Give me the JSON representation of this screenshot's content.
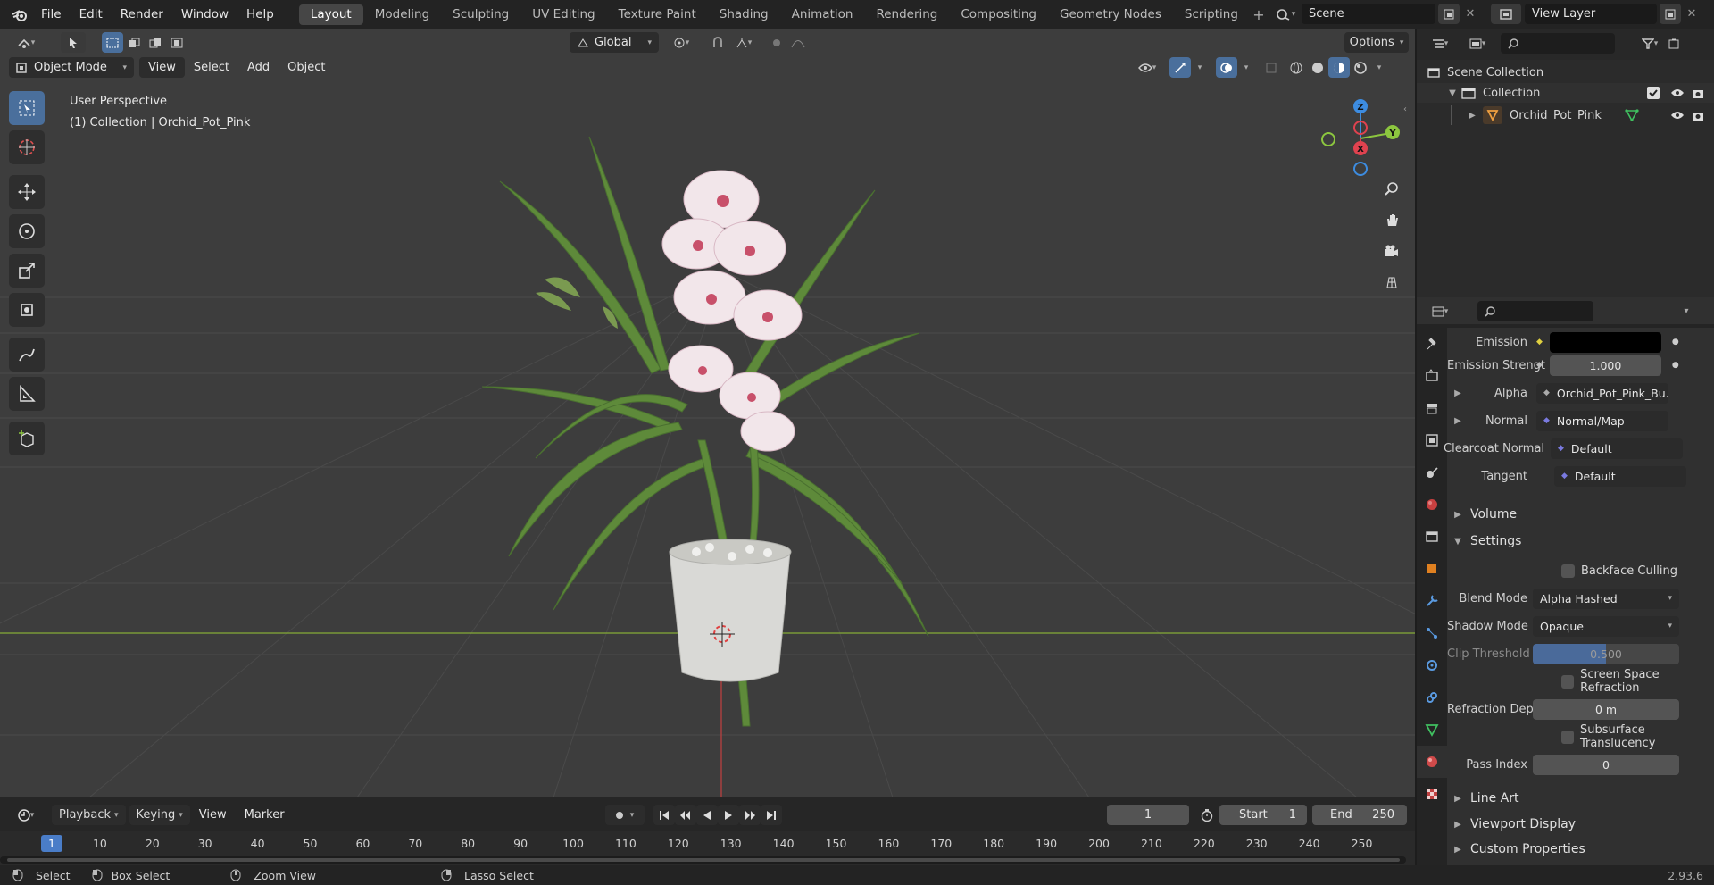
{
  "topbar": {
    "menus": [
      "File",
      "Edit",
      "Render",
      "Window",
      "Help"
    ],
    "workspaces": [
      "Layout",
      "Modeling",
      "Sculpting",
      "UV Editing",
      "Texture Paint",
      "Shading",
      "Animation",
      "Rendering",
      "Compositing",
      "Geometry Nodes",
      "Scripting"
    ],
    "active_workspace": "Layout",
    "scene": "Scene",
    "view_layer": "View Layer"
  },
  "viewport": {
    "mode": "Object Mode",
    "menus": [
      "View",
      "Select",
      "Add",
      "Object"
    ],
    "transform_orientation": "Global",
    "options_label": "Options",
    "overlay_line1": "User Perspective",
    "overlay_line2": "(1) Collection | Orchid_Pot_Pink",
    "gizmo_axes": {
      "x": "X",
      "y": "Y",
      "z": "Z"
    }
  },
  "outliner": {
    "root": "Scene Collection",
    "collection": "Collection",
    "object": "Orchid_Pot_Pink"
  },
  "properties": {
    "emission_label": "Emission",
    "emission_strength_label": "Emission Strengt",
    "emission_strength_value": "1.000",
    "alpha_label": "Alpha",
    "alpha_value": "Orchid_Pot_Pink_Bu...",
    "normal_label": "Normal",
    "normal_value": "Normal/Map",
    "clearcoat_normal_label": "Clearcoat Normal",
    "clearcoat_normal_value": "Default",
    "tangent_label": "Tangent",
    "tangent_value": "Default",
    "volume_section": "Volume",
    "settings_section": "Settings",
    "backface_culling": "Backface Culling",
    "blend_mode_label": "Blend Mode",
    "blend_mode_value": "Alpha Hashed",
    "shadow_mode_label": "Shadow Mode",
    "shadow_mode_value": "Opaque",
    "clip_threshold_label": "Clip Threshold",
    "clip_threshold_value": "0.500",
    "screen_space_refraction": "Screen Space Refraction",
    "refraction_depth_label": "Refraction Depth",
    "refraction_depth_value": "0 m",
    "subsurface_translucency": "Subsurface Translucency",
    "pass_index_label": "Pass Index",
    "pass_index_value": "0",
    "line_art_section": "Line Art",
    "viewport_display_section": "Viewport Display",
    "custom_properties_section": "Custom Properties"
  },
  "timeline": {
    "menus": [
      "Playback",
      "Keying",
      "View",
      "Marker"
    ],
    "current_frame": "1",
    "start_label": "Start",
    "start_value": "1",
    "end_label": "End",
    "end_value": "250",
    "ruler": [
      "1",
      "10",
      "20",
      "30",
      "40",
      "50",
      "60",
      "70",
      "80",
      "90",
      "100",
      "110",
      "120",
      "130",
      "140",
      "150",
      "160",
      "170",
      "180",
      "190",
      "200",
      "210",
      "220",
      "230",
      "240",
      "250"
    ]
  },
  "statusbar": {
    "select": "Select",
    "box_select": "Box Select",
    "zoom_view": "Zoom View",
    "lasso_select": "Lasso Select",
    "version": "2.93.6"
  },
  "colors": {
    "accent": "#4a6f9c",
    "x_axis": "#e0424f",
    "y_axis": "#8cc63f",
    "z_axis": "#3d8ce0"
  }
}
